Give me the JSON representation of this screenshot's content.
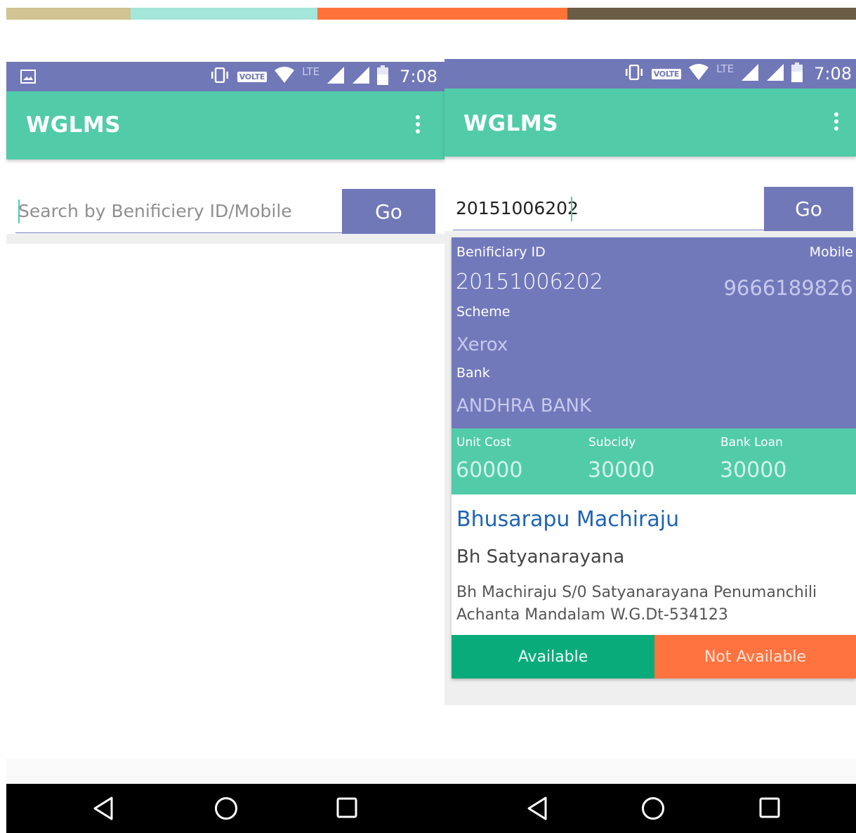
{
  "palette": [
    "#d1c392",
    "#a4e7da",
    "#ff7339",
    "#6b5c46"
  ],
  "colors": {
    "status_bar": "#7178b8",
    "app_bar": "#52cba9",
    "card_primary": "#7279bb",
    "available": "#0aab7b",
    "not_available": "#ff7340",
    "name_link": "#1e63b7"
  },
  "status_bar": {
    "volte": "VOLTE",
    "network": "LTE",
    "time": "7:08"
  },
  "left_screen": {
    "app_title": "WGLMS",
    "search": {
      "placeholder": "Search by Benificiery ID/Mobile",
      "value": ""
    },
    "go_label": "Go"
  },
  "right_screen": {
    "app_title": "WGLMS",
    "search": {
      "placeholder": "Search by Benificiery ID/Mobile",
      "value": "20151006202"
    },
    "go_label": "Go",
    "card": {
      "beneficiary_id_label": "Benificiary ID",
      "beneficiary_id": "20151006202",
      "mobile_label": "Mobile",
      "mobile": "9666189826",
      "scheme_label": "Scheme",
      "scheme": "Xerox",
      "bank_label": "Bank",
      "bank": "ANDHRA BANK",
      "unit_cost_label": "Unit Cost",
      "unit_cost": "60000",
      "subsidy_label": "Subcidy",
      "subsidy": "30000",
      "bank_loan_label": "Bank Loan",
      "bank_loan": "30000",
      "name": "Bhusarapu Machiraju",
      "father_name": "Bh Satyanarayana",
      "address": "Bh Machiraju S/0 Satyanarayana Penumanchili Achanta Mandalam W.G.Dt-534123",
      "available_label": "Available",
      "not_available_label": "Not Available"
    }
  },
  "icons": {
    "status": [
      "gallery-icon",
      "vibrate-icon",
      "wifi-icon",
      "signal-icon",
      "battery-icon"
    ],
    "app_bar": [
      "overflow-menu-icon"
    ],
    "nav": [
      "back-icon",
      "home-icon",
      "recents-icon"
    ]
  }
}
